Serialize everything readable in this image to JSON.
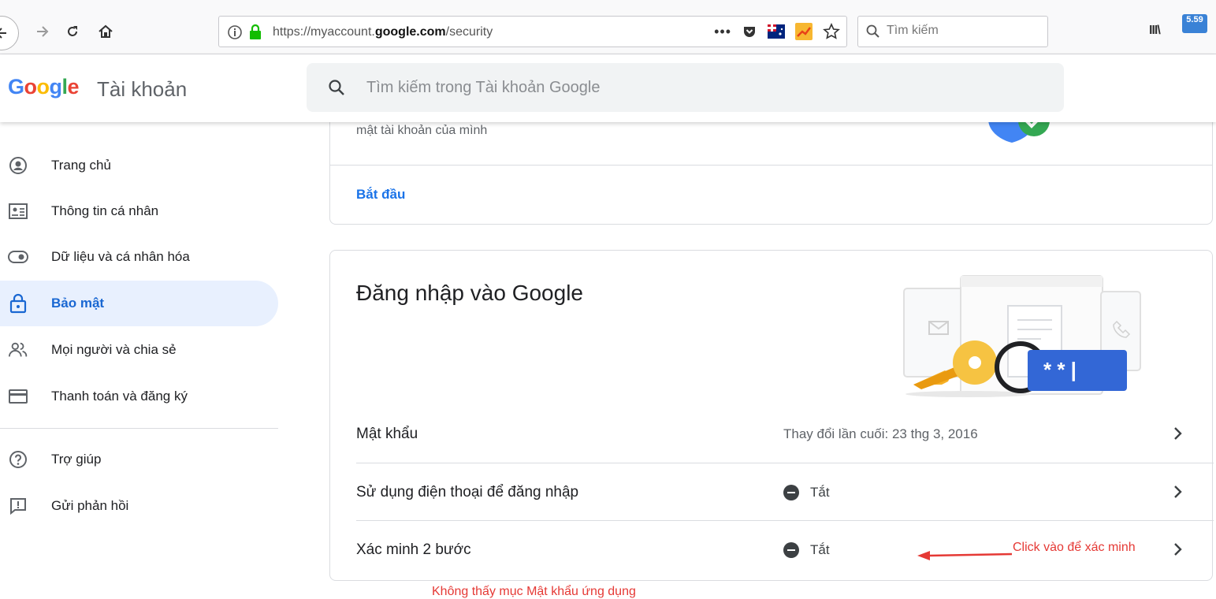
{
  "browser": {
    "url_prefix": "https://myaccount.",
    "url_domain": "google.com",
    "url_path": "/security",
    "url_dots": "•••",
    "search_placeholder": "Tìm kiếm",
    "library_label": "III\\",
    "badge_text": "5.59"
  },
  "header": {
    "logo_g1": "G",
    "logo_o1": "o",
    "logo_o2": "o",
    "logo_g2": "g",
    "logo_l": "l",
    "logo_e": "e",
    "product": "Tài khoản",
    "search_placeholder": "Tìm kiếm trong Tài khoản Google"
  },
  "sidebar": {
    "items": [
      {
        "label": "Trang chủ",
        "icon": "account-circle-icon"
      },
      {
        "label": "Thông tin cá nhân",
        "icon": "id-card-icon"
      },
      {
        "label": "Dữ liệu và cá nhân hóa",
        "icon": "toggle-icon"
      },
      {
        "label": "Bảo mật",
        "icon": "lock-icon",
        "active": true
      },
      {
        "label": "Mọi người và chia sẻ",
        "icon": "people-icon"
      },
      {
        "label": "Thanh toán và đăng ký",
        "icon": "credit-card-icon"
      },
      {
        "label": "Trợ giúp",
        "icon": "help-icon"
      },
      {
        "label": "Gửi phản hồi",
        "icon": "feedback-icon"
      }
    ]
  },
  "top_card": {
    "hint": "mật tài khoản của mình",
    "start_link": "Bắt đầu"
  },
  "signin_card": {
    "title": "Đăng nhập vào Google",
    "art_password_mask": "* * |",
    "rows": [
      {
        "label": "Mật khẩu",
        "value": "Thay đổi lần cuối: 23 thg 3, 2016"
      },
      {
        "label": "Sử dụng điện thoại để đăng nhập",
        "value": "Tắt"
      },
      {
        "label": "Xác minh 2 bước",
        "value": "Tắt"
      }
    ]
  },
  "annotation": {
    "text": "Click vào để xác minh",
    "bottom_note": "Không thấy mục Mật khẩu ứng dụng"
  },
  "colors": {
    "accent": "#1a73e8",
    "active_bg": "#e8f0fe",
    "annotation": "#e53935"
  }
}
